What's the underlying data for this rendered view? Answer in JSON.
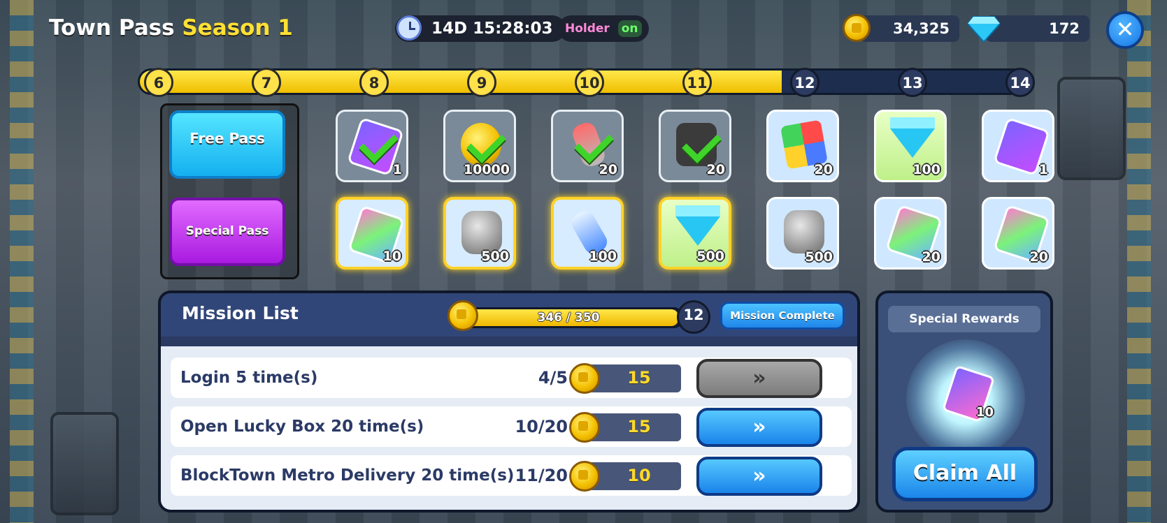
{
  "header": {
    "title_main": "Town Pass",
    "title_season": "Season 1",
    "timer": "14D 15:28:03",
    "holder_label": "Holder",
    "holder_state": "on",
    "coins": "34,325",
    "gems": "172"
  },
  "levels": [
    "6",
    "7",
    "8",
    "9",
    "10",
    "11",
    "12",
    "13",
    "14"
  ],
  "levels_reached": 6,
  "passes": {
    "free": "Free Pass",
    "special": "Special Pass"
  },
  "free_rewards": [
    {
      "qty": "1",
      "item": "card-icon",
      "claimed": true
    },
    {
      "qty": "10000",
      "item": "coin-icon",
      "claimed": true
    },
    {
      "qty": "20",
      "item": "battery-icon",
      "claimed": true
    },
    {
      "qty": "20",
      "item": "gear-icon",
      "claimed": true
    },
    {
      "qty": "20",
      "item": "blocks-icon",
      "claimed": false
    },
    {
      "qty": "100",
      "item": "gem-icon",
      "claimed": false
    },
    {
      "qty": "1",
      "item": "bonus-card-icon",
      "claimed": false
    }
  ],
  "special_rewards_row": [
    {
      "qty": "10",
      "item": "card-icon"
    },
    {
      "qty": "500",
      "item": "rock-icon"
    },
    {
      "qty": "100",
      "item": "battery-icon"
    },
    {
      "qty": "500",
      "item": "gem-icon"
    },
    {
      "qty": "500",
      "item": "rock-icon"
    },
    {
      "qty": "20",
      "item": "card-icon"
    },
    {
      "qty": "20",
      "item": "card-icon"
    }
  ],
  "mission": {
    "title": "Mission List",
    "progress_text": "346 / 350",
    "progress_fraction": 0.989,
    "next_level": "12",
    "complete_label": "Mission Complete",
    "rows": [
      {
        "name": "Login 5 time(s)",
        "progress": "4/5",
        "reward": "15",
        "done": false
      },
      {
        "name": "Open Lucky Box 20 time(s)",
        "progress": "10/20",
        "reward": "15",
        "done": true
      },
      {
        "name": "BlockTown Metro Delivery 20 time(s)",
        "progress": "11/20",
        "reward": "10",
        "done": true
      }
    ],
    "go_label": "»"
  },
  "special_panel": {
    "title": "Special Rewards",
    "qty": "10",
    "claim_label": "Claim All"
  },
  "colors": {
    "accent_yellow": "#ffe033",
    "button_blue": "#1f86ea",
    "panel_navy": "#2a3a62"
  }
}
